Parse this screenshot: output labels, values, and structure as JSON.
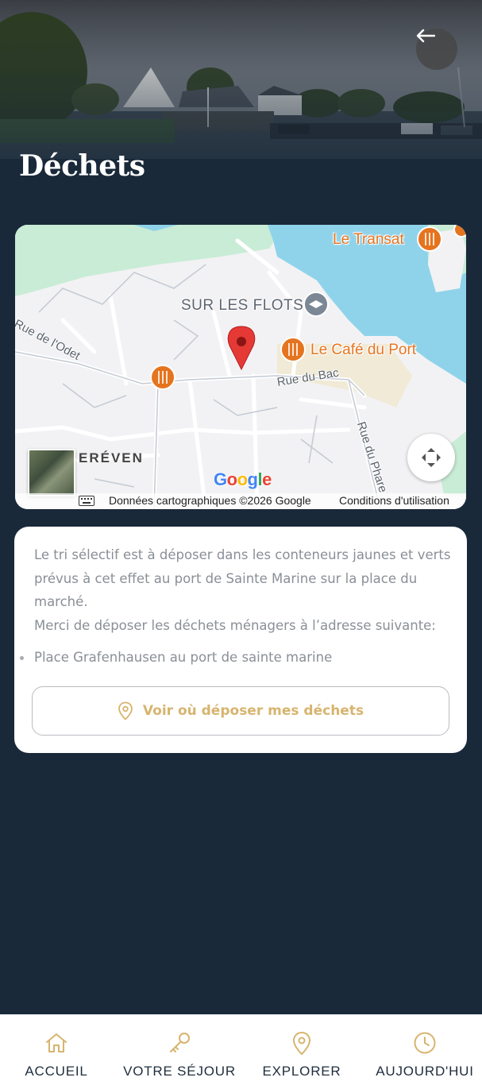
{
  "header": {
    "title": "Déchets",
    "back_icon": "arrow-left-icon"
  },
  "map": {
    "pois": {
      "transat": "Le Transat",
      "cafe": "Le Café du Port",
      "school": "SUR LES FLOTS"
    },
    "streets": {
      "odet": "Rue de l'Odet",
      "bac": "Rue du Bac",
      "phare": "Rue du Phare"
    },
    "district": "ERÉVEN",
    "logo": "Google",
    "attribution": "Données cartographiques ©2026 Google",
    "terms": "Conditions d'utilisation",
    "colors": {
      "water": "#8fd3ea",
      "park": "#c9ecd6",
      "land": "#f2f2f4",
      "pin": "#e53935",
      "poi": "#e5741f"
    }
  },
  "card": {
    "paragraph1": "Le tri sélectif est à déposer dans les conteneurs jaunes et verts prévus à cet effet au port de Sainte Marine sur la place du marché.",
    "paragraph2": "Merci de déposer les déchets ménagers à l’adresse suivante:",
    "list": [
      "Place Grafenhausen au port de sainte marine"
    ],
    "button_label": "Voir où déposer mes déchets",
    "button_icon": "map-pin-icon",
    "accent_color": "#d7b46e"
  },
  "nav": {
    "items": [
      {
        "label": "ACCUEIL",
        "icon": "home-icon"
      },
      {
        "label": "VOTRE SÉJOUR",
        "icon": "key-icon"
      },
      {
        "label": "EXPLORER",
        "icon": "map-pin-icon"
      },
      {
        "label": "AUJOURD'HUI",
        "icon": "clock-icon"
      }
    ]
  }
}
